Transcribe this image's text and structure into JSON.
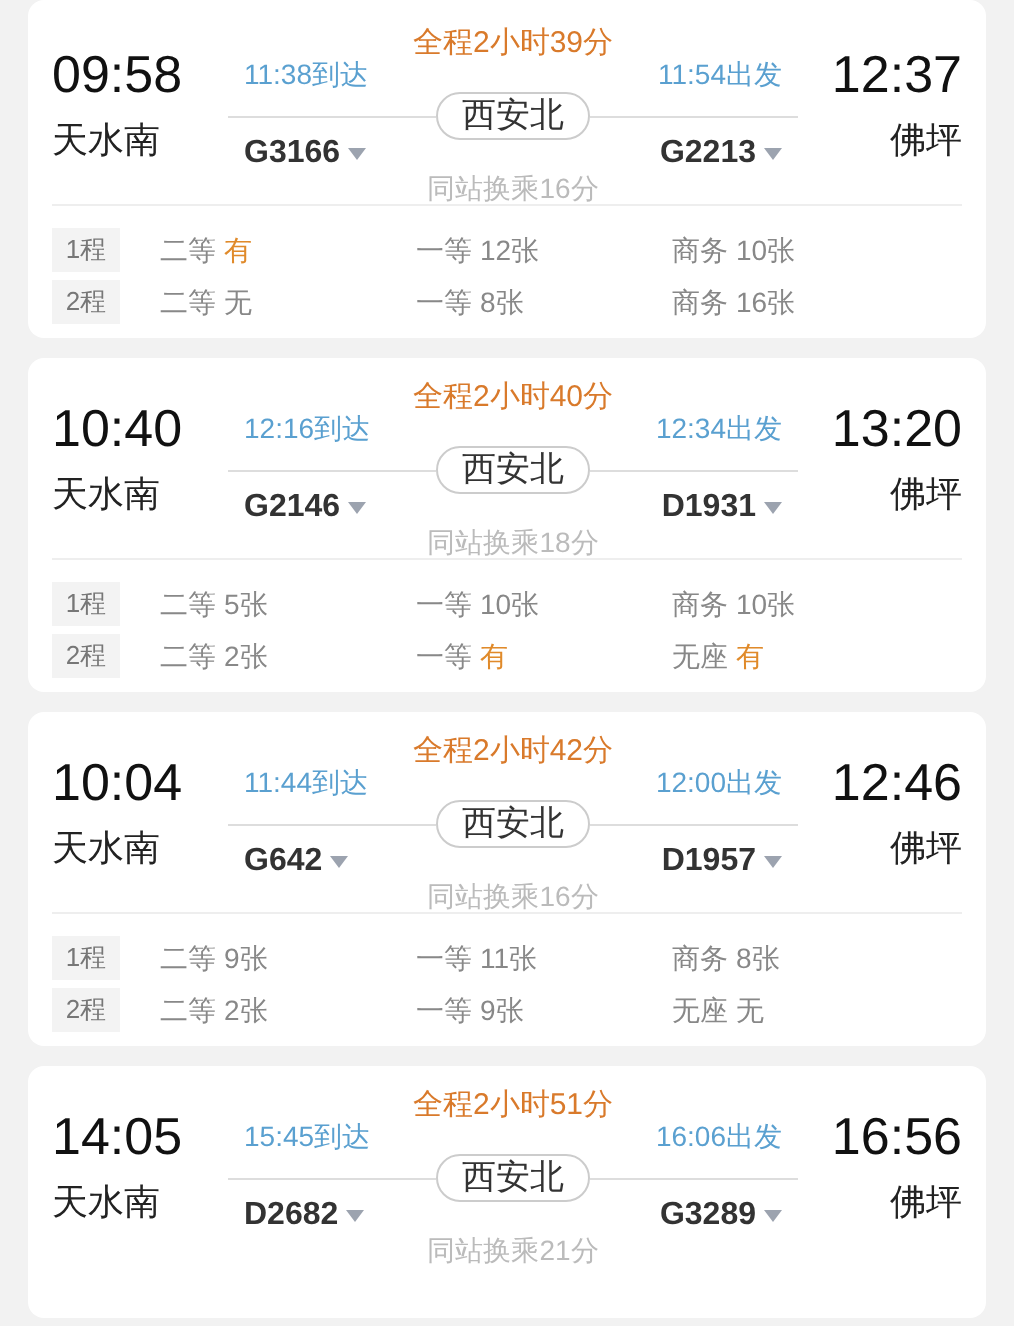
{
  "trips": [
    {
      "depart_time": "09:58",
      "from": "天水南",
      "arrive_time": "12:37",
      "to": "佛坪",
      "duration": "全程2小时39分",
      "leg1_arrive": "11:38到达",
      "leg2_depart": "11:54出发",
      "transfer_station": "西安北",
      "train1": "G3166",
      "train2": "G2213",
      "transfer_note": "同站换乘16分",
      "legs": [
        {
          "label": "1程",
          "seats": [
            {
              "class": "二等",
              "value": "有",
              "highlight": true
            },
            {
              "class": "一等",
              "value": "12张",
              "highlight": false
            },
            {
              "class": "商务",
              "value": "10张",
              "highlight": false
            }
          ]
        },
        {
          "label": "2程",
          "seats": [
            {
              "class": "二等",
              "value": "无",
              "highlight": false
            },
            {
              "class": "一等",
              "value": "8张",
              "highlight": false
            },
            {
              "class": "商务",
              "value": "16张",
              "highlight": false
            }
          ]
        }
      ]
    },
    {
      "depart_time": "10:40",
      "from": "天水南",
      "arrive_time": "13:20",
      "to": "佛坪",
      "duration": "全程2小时40分",
      "leg1_arrive": "12:16到达",
      "leg2_depart": "12:34出发",
      "transfer_station": "西安北",
      "train1": "G2146",
      "train2": "D1931",
      "transfer_note": "同站换乘18分",
      "legs": [
        {
          "label": "1程",
          "seats": [
            {
              "class": "二等",
              "value": "5张",
              "highlight": false
            },
            {
              "class": "一等",
              "value": "10张",
              "highlight": false
            },
            {
              "class": "商务",
              "value": "10张",
              "highlight": false
            }
          ]
        },
        {
          "label": "2程",
          "seats": [
            {
              "class": "二等",
              "value": "2张",
              "highlight": false
            },
            {
              "class": "一等",
              "value": "有",
              "highlight": true
            },
            {
              "class": "无座",
              "value": "有",
              "highlight": true
            }
          ]
        }
      ]
    },
    {
      "depart_time": "10:04",
      "from": "天水南",
      "arrive_time": "12:46",
      "to": "佛坪",
      "duration": "全程2小时42分",
      "leg1_arrive": "11:44到达",
      "leg2_depart": "12:00出发",
      "transfer_station": "西安北",
      "train1": "G642",
      "train2": "D1957",
      "transfer_note": "同站换乘16分",
      "legs": [
        {
          "label": "1程",
          "seats": [
            {
              "class": "二等",
              "value": "9张",
              "highlight": false
            },
            {
              "class": "一等",
              "value": "11张",
              "highlight": false
            },
            {
              "class": "商务",
              "value": "8张",
              "highlight": false
            }
          ]
        },
        {
          "label": "2程",
          "seats": [
            {
              "class": "二等",
              "value": "2张",
              "highlight": false
            },
            {
              "class": "一等",
              "value": "9张",
              "highlight": false
            },
            {
              "class": "无座",
              "value": "无",
              "highlight": false
            }
          ]
        }
      ]
    },
    {
      "depart_time": "14:05",
      "from": "天水南",
      "arrive_time": "16:56",
      "to": "佛坪",
      "duration": "全程2小时51分",
      "leg1_arrive": "15:45到达",
      "leg2_depart": "16:06出发",
      "transfer_station": "西安北",
      "train1": "D2682",
      "train2": "G3289",
      "transfer_note": "同站换乘21分"
    }
  ]
}
